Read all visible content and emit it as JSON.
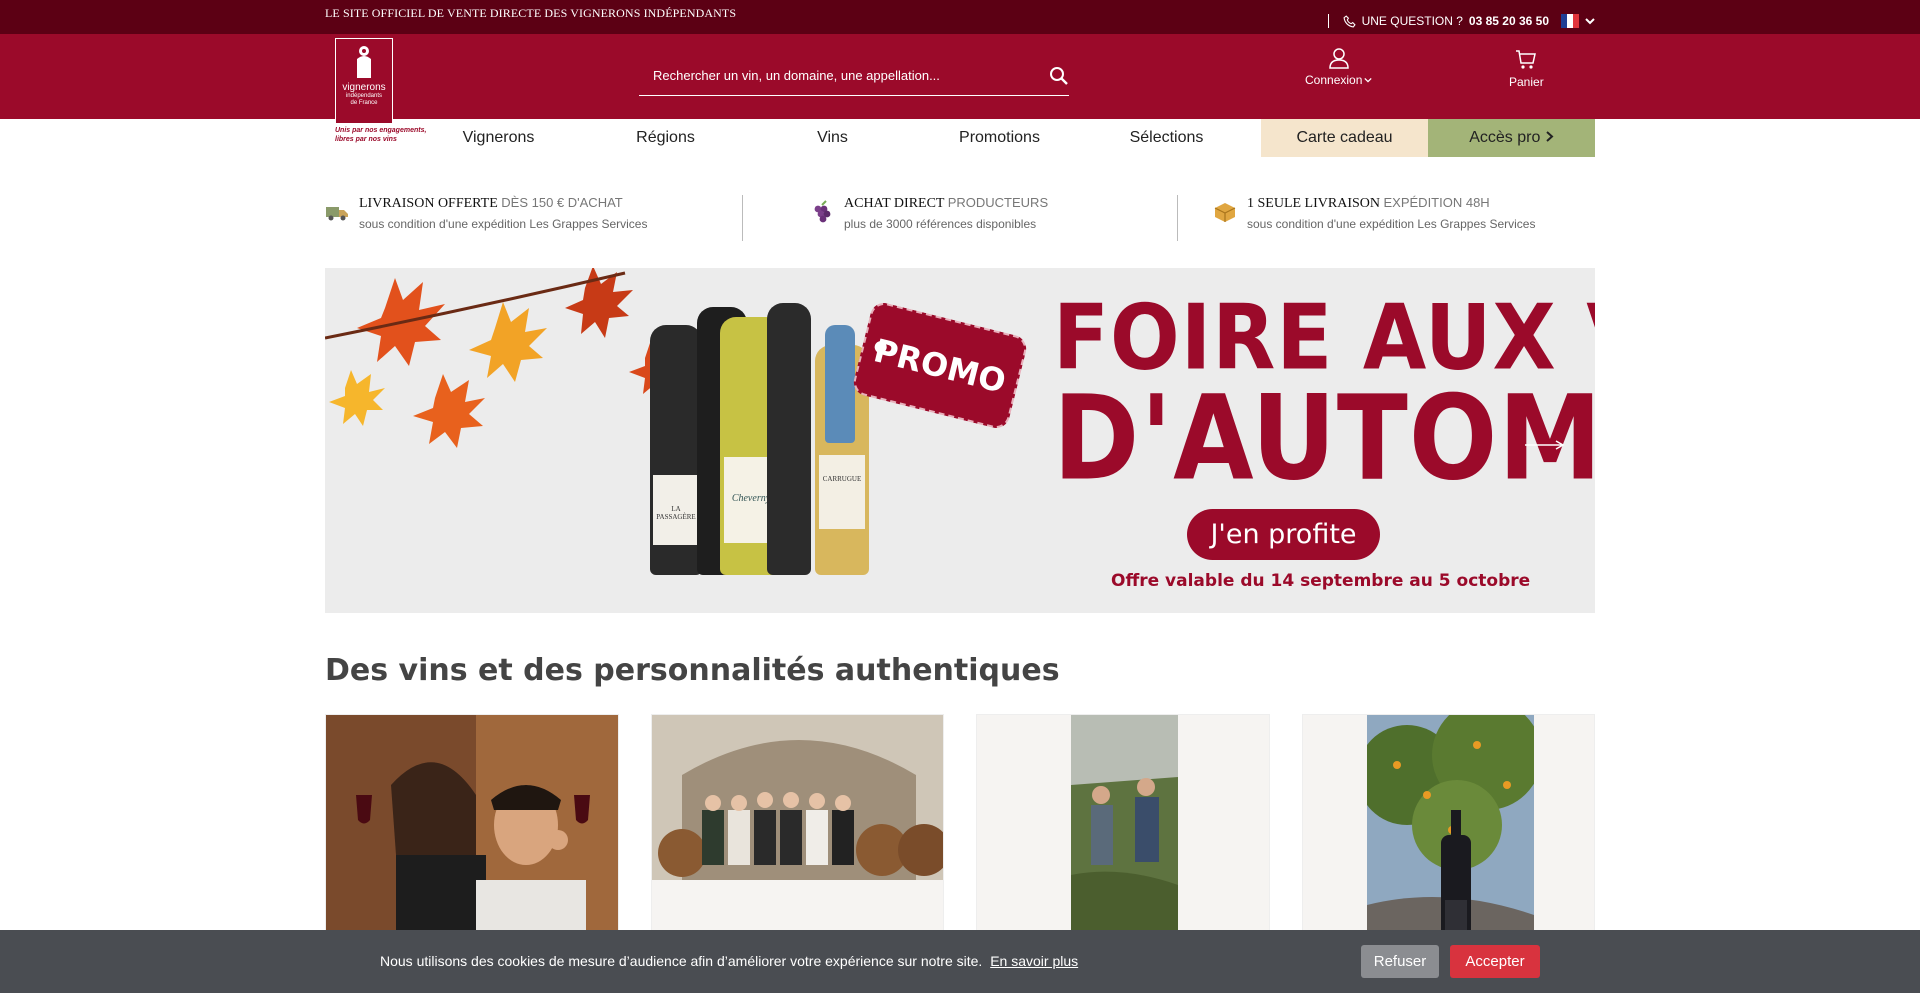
{
  "topbar": {
    "left_text": "LE SITE OFFICIEL DE VENTE DIRECTE DES VIGNERONS INDÉPENDANTS",
    "question_label": "UNE QUESTION ?",
    "phone": "03 85 20 36 50"
  },
  "logo": {
    "line1": "vignerons",
    "line2": "indépendants",
    "line3": "de France",
    "tagline1": "Unis par nos engagements,",
    "tagline2": "libres par nos vins"
  },
  "search": {
    "placeholder": "Rechercher un vin, un domaine, une appellation..."
  },
  "header": {
    "login_label": "Connexion",
    "cart_label": "Panier"
  },
  "nav": {
    "items": [
      {
        "label": "Vignerons"
      },
      {
        "label": "Régions"
      },
      {
        "label": "Vins"
      },
      {
        "label": "Promotions"
      },
      {
        "label": "Sélections"
      }
    ],
    "gift_label": "Carte cadeau",
    "pro_label": "Accès pro"
  },
  "features": [
    {
      "title": "LIVRAISON OFFERTE",
      "title_light": "DÈS 150 € D'ACHAT",
      "subtitle": "sous condition d'une expédition Les Grappes Services"
    },
    {
      "title": "ACHAT DIRECT",
      "title_light": "PRODUCTEURS",
      "subtitle": "plus de 3000 références disponibles"
    },
    {
      "title": "1 SEULE LIVRAISON",
      "title_light": "EXPÉDITION 48H",
      "subtitle": "sous condition d'une expédition Les Grappes Services"
    }
  ],
  "banner": {
    "promo": "PROMO",
    "title_line1": "FOIRE AUX VINS",
    "title_line2": "D'AUTOMNE",
    "cta": "J'en profite",
    "offer": "Offre valable du 14 septembre au 5 octobre",
    "label_bottle1": "LA PASSAGÈRE",
    "label_bottle2": "Cheverny",
    "label_bottle3": "CARRUGUE"
  },
  "section": {
    "title": "Des vins et des personnalités authentiques"
  },
  "cookie": {
    "text": "Nous utilisons des cookies de mesure d’audience afin d’améliorer votre expérience sur notre site.",
    "link": "En savoir plus",
    "refuse": "Refuser",
    "accept": "Accepter"
  },
  "colors": {
    "brand": "#9b0a2a",
    "topbar": "#5c0014",
    "gift_bg": "#f5e5cc",
    "pro_bg": "#a3b478",
    "accept": "#d8333e"
  }
}
